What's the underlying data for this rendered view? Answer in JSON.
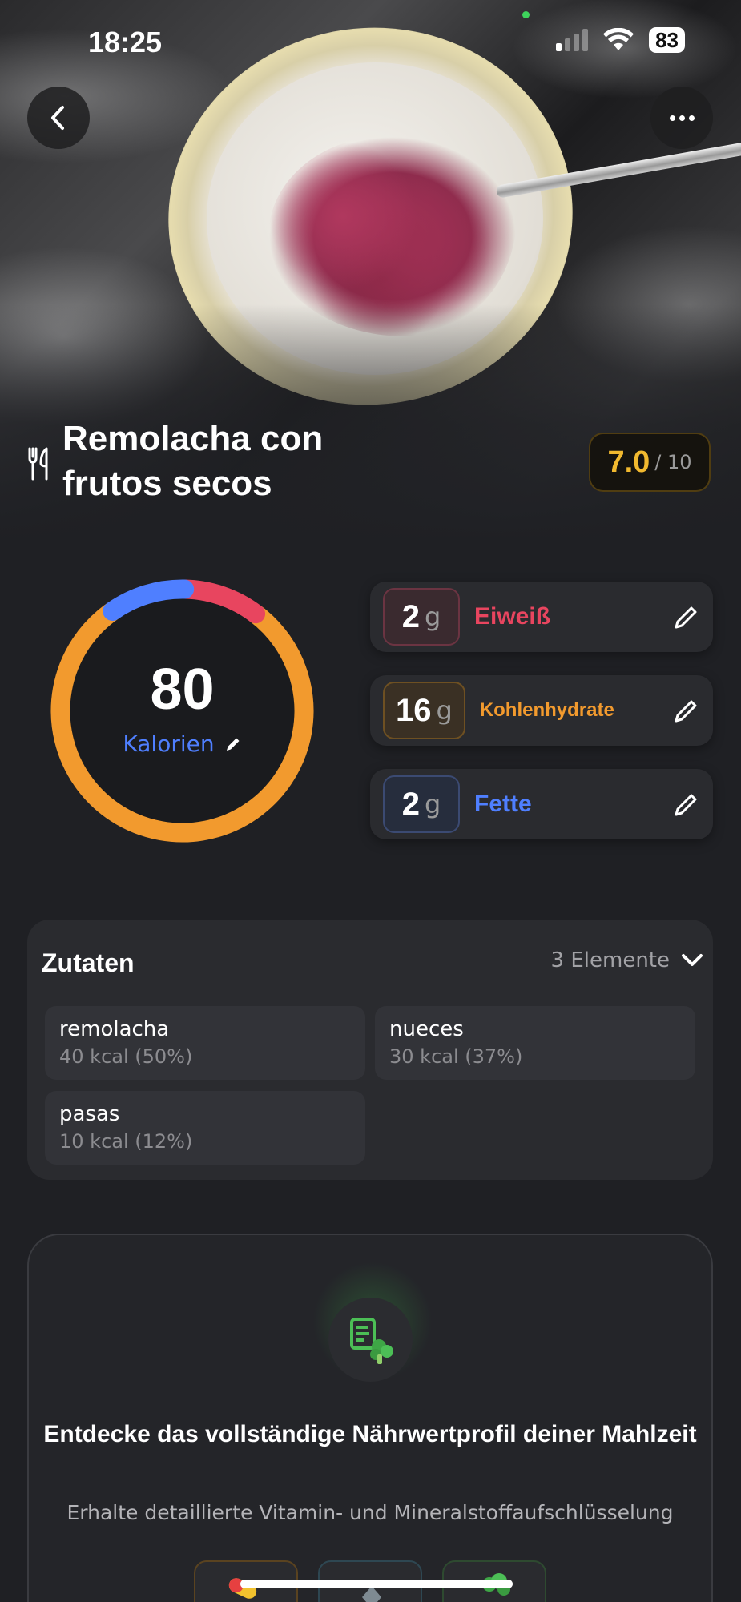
{
  "status_bar": {
    "time": "18:25",
    "battery": "83"
  },
  "meal": {
    "title": "Remolacha con frutos secos",
    "score": "7.0",
    "score_max": "/ 10"
  },
  "calories": {
    "value": "80",
    "label": "Kalorien"
  },
  "macros": [
    {
      "amount": "2",
      "unit": "g",
      "name": "Eiweiß",
      "color": "#e8455f"
    },
    {
      "amount": "16",
      "unit": "g",
      "name": "Kohlenhydrate",
      "color": "#f29a2e"
    },
    {
      "amount": "2",
      "unit": "g",
      "name": "Fette",
      "color": "#4f7fff"
    }
  ],
  "ring": {
    "protein_pct": 0.1,
    "carbs_pct": 0.8,
    "fat_pct": 0.1
  },
  "ingredients": {
    "title": "Zutaten",
    "count": "3 Elemente",
    "items": [
      {
        "name": "remolacha",
        "kcal": "40 kcal (50%)"
      },
      {
        "name": "nueces",
        "kcal": "30 kcal (37%)"
      },
      {
        "name": "pasas",
        "kcal": "10 kcal (12%)"
      }
    ]
  },
  "promo": {
    "title": "Entdecke das vollständige Nährwertprofil deiner Mahlzeit",
    "subtitle": "Erhalte detaillierte Vitamin- und Mineralstoffaufschlüsselung"
  },
  "icons": [
    "back-icon",
    "more-icon",
    "fork-knife-icon",
    "pencil-icon",
    "chevron-down-icon",
    "nutrition-report-icon"
  ]
}
